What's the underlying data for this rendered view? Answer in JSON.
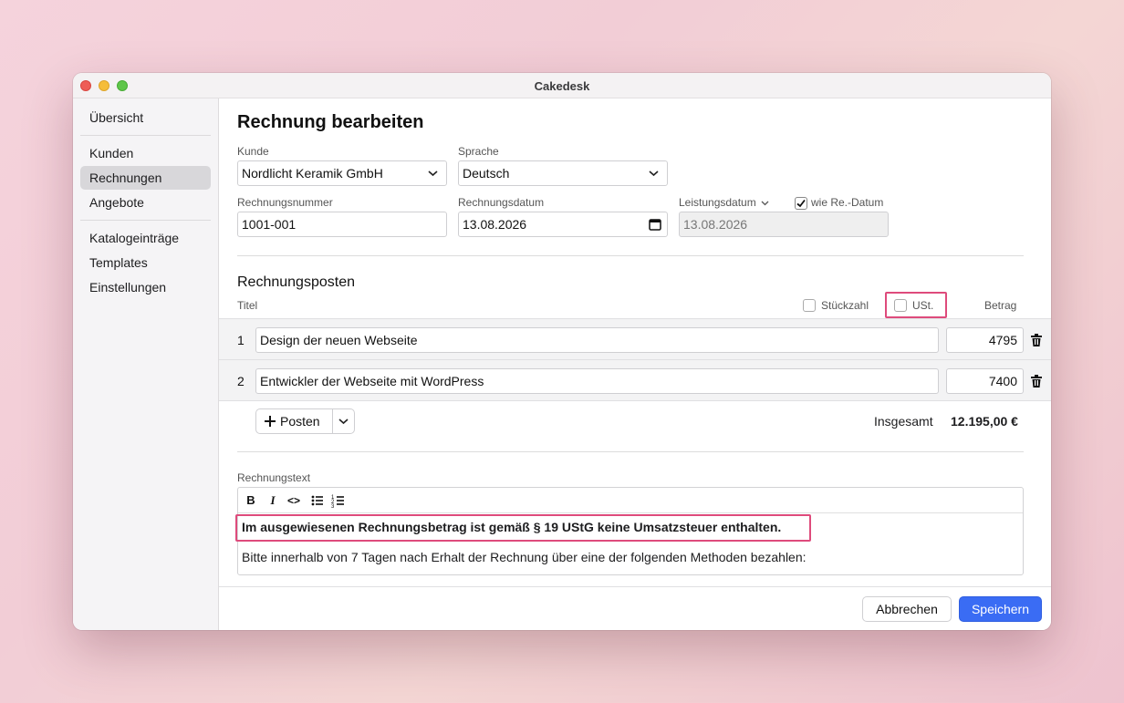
{
  "window": {
    "title": "Cakedesk"
  },
  "sidebar": {
    "items": [
      {
        "label": "Übersicht"
      },
      {
        "label": "Kunden"
      },
      {
        "label": "Rechnungen"
      },
      {
        "label": "Angebote"
      },
      {
        "label": "Katalogeinträge"
      },
      {
        "label": "Templates"
      },
      {
        "label": "Einstellungen"
      }
    ],
    "active": "Rechnungen"
  },
  "page": {
    "title": "Rechnung bearbeiten"
  },
  "form": {
    "kunde": {
      "label": "Kunde",
      "value": "Nordlicht Keramik GmbH"
    },
    "sprache": {
      "label": "Sprache",
      "value": "Deutsch"
    },
    "rechnungsnummer": {
      "label": "Rechnungsnummer",
      "value": "1001-001"
    },
    "rechnungsdatum": {
      "label": "Rechnungsdatum",
      "value": "13.08.2026"
    },
    "leistungsdatum": {
      "label": "Leistungsdatum",
      "value": "13.08.2026",
      "same_as_label": "wie Re.-Datum",
      "same_as_checked": true
    }
  },
  "posten": {
    "title": "Rechnungsposten",
    "col_titel": "Titel",
    "col_stueckzahl": "Stückzahl",
    "col_ust": "USt.",
    "col_betrag": "Betrag",
    "stueckzahl_checked": false,
    "ust_checked": false,
    "items": [
      {
        "num": "1",
        "title": "Design der neuen Webseite",
        "amount": "4795"
      },
      {
        "num": "2",
        "title": "Entwickler der Webseite mit WordPress",
        "amount": "7400"
      }
    ],
    "add_label": "Posten",
    "total_label": "Insgesamt",
    "total_value": "12.195,00 €"
  },
  "rechnungstext": {
    "label": "Rechnungstext",
    "toolbar": [
      "B",
      "I",
      "<>",
      "bullet-list",
      "numbered-list"
    ],
    "line1": "Im ausgewiesenen Rechnungsbetrag ist gemäß § 19 UStG keine Umsatzsteuer enthalten.",
    "line2": "Bitte innerhalb von 7 Tagen nach Erhalt der Rechnung über eine der folgenden Methoden bezahlen:"
  },
  "footer": {
    "cancel": "Abbrechen",
    "save": "Speichern"
  },
  "colors": {
    "accent": "#3a6cf4",
    "highlight": "#de4b7c"
  }
}
